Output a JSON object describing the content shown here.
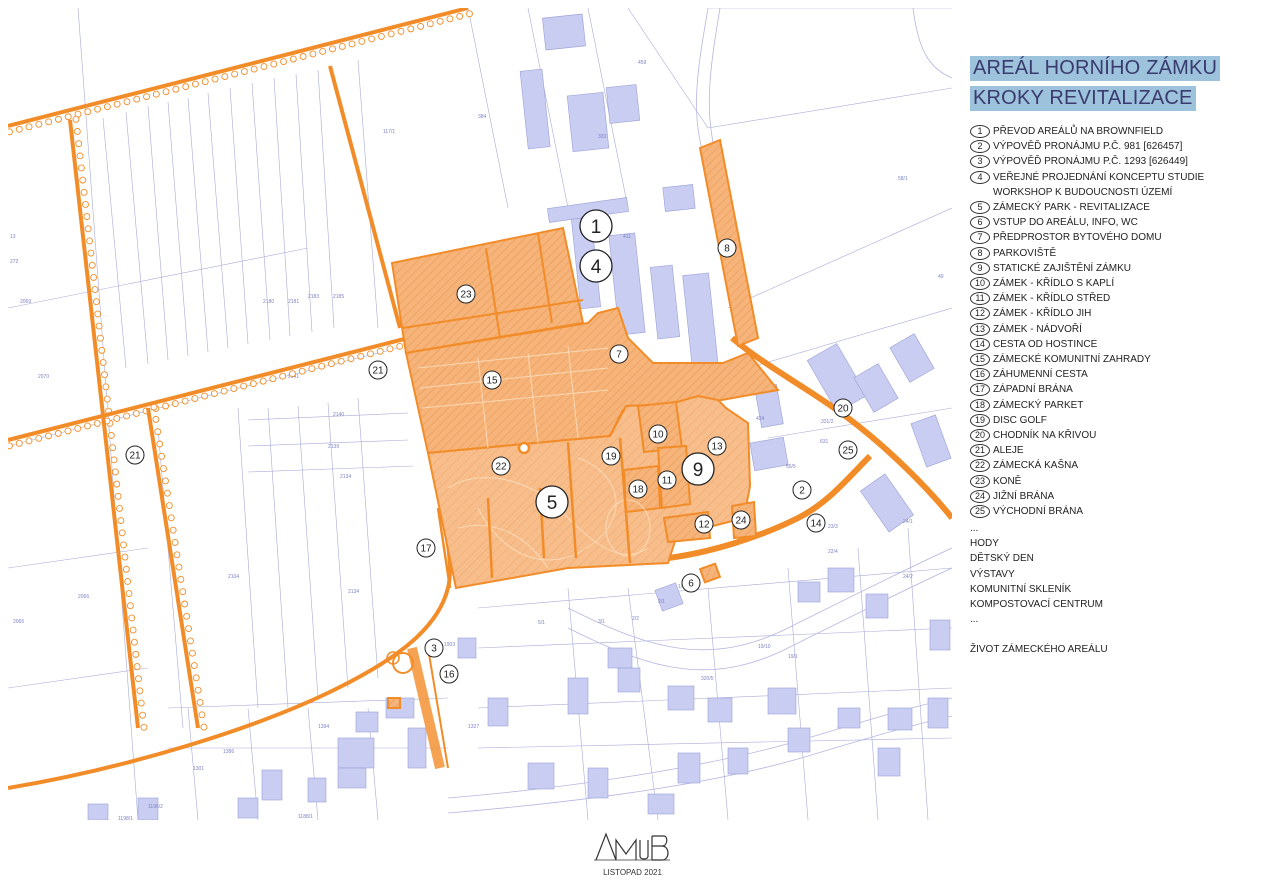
{
  "title": {
    "line1": "AREÁL HORNÍHO ZÁMKU",
    "line2": "KROKY REVITALIZACE"
  },
  "legend": [
    {
      "num": "1",
      "text": "PŘEVOD AREÁLŮ NA BROWNFIELD"
    },
    {
      "num": "2",
      "text": "VÝPOVĚĎ PRONÁJMU P.Č. 981 [626457]"
    },
    {
      "num": "3",
      "text": "VÝPOVĚĎ PRONÁJMU P.Č. 1293 [626449]"
    },
    {
      "num": "4",
      "text": "VEŘEJNÉ PROJEDNÁNÍ KONCEPTU STUDIE\nWORKSHOP K BUDOUCNOSTI ÚZEMÍ"
    },
    {
      "num": "5",
      "text": "ZÁMECKÝ PARK - REVITALIZACE"
    },
    {
      "num": "6",
      "text": "VSTUP DO AREÁLU, INFO, WC"
    },
    {
      "num": "7",
      "text": "PŘEDPROSTOR BYTOVÉHO DOMU"
    },
    {
      "num": "8",
      "text": "PARKOVIŠTĚ"
    },
    {
      "num": "9",
      "text": "STATICKÉ ZAJIŠTĚNÍ ZÁMKU"
    },
    {
      "num": "10",
      "text": "ZÁMEK - KŘÍDLO S KAPLÍ"
    },
    {
      "num": "11",
      "text": "ZÁMEK - KŘÍDLO STŘED"
    },
    {
      "num": "12",
      "text": "ZÁMEK - KŘÍDLO JIH"
    },
    {
      "num": "13",
      "text": "ZÁMEK - NÁDVOŘÍ"
    },
    {
      "num": "14",
      "text": "CESTA OD HOSTINCE"
    },
    {
      "num": "15",
      "text": "ZÁMECKÉ KOMUNITNÍ ZAHRADY"
    },
    {
      "num": "16",
      "text": "ZÁHUMENNÍ CESTA"
    },
    {
      "num": "17",
      "text": "ZÁPADNÍ BRÁNA"
    },
    {
      "num": "18",
      "text": "ZÁMECKÝ PARKET"
    },
    {
      "num": "19",
      "text": "DISC GOLF"
    },
    {
      "num": "20",
      "text": "CHODNÍK NA KŘIVOU"
    },
    {
      "num": "21",
      "text": "ALEJE"
    },
    {
      "num": "22",
      "text": "ZÁMECKÁ KAŠNA"
    },
    {
      "num": "23",
      "text": "KONĚ"
    },
    {
      "num": "24",
      "text": "JIŽNÍ BRÁNA"
    },
    {
      "num": "25",
      "text": "VÝCHODNÍ BRÁNA"
    }
  ],
  "extras": [
    "...",
    "HODY",
    "DĚTSKÝ DEN",
    "VÝSTAVY",
    "KOMUNITNÍ SKLENÍK",
    "KOMPOSTOVACÍ CENTRUM",
    "..."
  ],
  "footer_tag": "ŽIVOT ZÁMECKÉHO AREÁLU",
  "date": "LISTOPAD 2021",
  "colors": {
    "accent_orange": "#f28c28",
    "fill_orange": "#f6b47a",
    "building_blue": "#c9cdf2",
    "parcel_line": "#a8acd8",
    "title_bg": "#9dc3dc"
  },
  "map_markers": [
    {
      "num": "1"
    },
    {
      "num": "4"
    },
    {
      "num": "5"
    },
    {
      "num": "9"
    },
    {
      "num": "2"
    },
    {
      "num": "3"
    },
    {
      "num": "6"
    },
    {
      "num": "7"
    },
    {
      "num": "8"
    },
    {
      "num": "10"
    },
    {
      "num": "11"
    },
    {
      "num": "12"
    },
    {
      "num": "13"
    },
    {
      "num": "14"
    },
    {
      "num": "15"
    },
    {
      "num": "16"
    },
    {
      "num": "17"
    },
    {
      "num": "18"
    },
    {
      "num": "19"
    },
    {
      "num": "20"
    },
    {
      "num": "21"
    },
    {
      "num": "21"
    },
    {
      "num": "22"
    },
    {
      "num": "23"
    },
    {
      "num": "24"
    },
    {
      "num": "25"
    }
  ]
}
